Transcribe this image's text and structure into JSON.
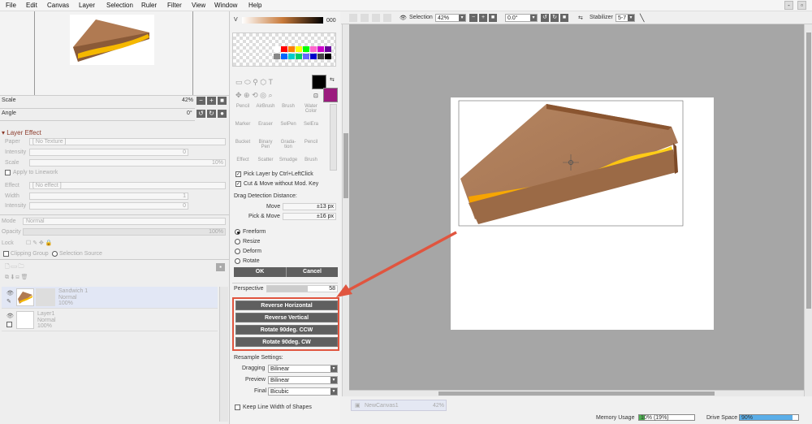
{
  "menu": [
    "File",
    "Edit",
    "Canvas",
    "Layer",
    "Selection",
    "Ruler",
    "Filter",
    "View",
    "Window",
    "Help"
  ],
  "window_controls": {
    "minimize": "-",
    "restore": "▫"
  },
  "navigator": {
    "scale_label": "Scale",
    "scale_value": "42%",
    "angle_label": "Angle",
    "angle_value": "0°"
  },
  "layer_effect": {
    "title": "Layer Effect",
    "paper_label": "Paper",
    "paper_value": "[ No Texture ]",
    "intensity_label": "Intensity",
    "intensity_value": "0",
    "scale_label": "Scale",
    "scale_value": "10%",
    "apply_linework": "Apply to Linework",
    "effect_label": "Effect",
    "effect_value": "[ No effect ]",
    "width_label": "Width",
    "width_value": "1",
    "intensity2_label": "Intensity",
    "intensity2_value": "0"
  },
  "layer_props": {
    "mode_label": "Mode",
    "mode_value": "Normal",
    "opacity_label": "Opacity",
    "opacity_value": "100%",
    "lock_label": "Lock",
    "clipping_group": "Clipping Group",
    "selection_source": "Selection Source"
  },
  "layers": [
    {
      "name": "Sandwich 1",
      "mode": "Normal",
      "opacity": "100%"
    },
    {
      "name": "Layer1",
      "mode": "Normal",
      "opacity": "100%"
    }
  ],
  "color": {
    "v_label": "V",
    "v_value": "000",
    "primary": "#000000",
    "secondary": "#9b1b7e"
  },
  "palette": [
    "#ffffff",
    "#ff0000",
    "#ff7f00",
    "#ffff00",
    "#00ff00",
    "#ff66cc",
    "#cc00cc",
    "#660099",
    "#888888",
    "#0066ff",
    "#00cccc",
    "#00cc66",
    "#6666ff",
    "#0000cc",
    "#444444",
    "#000000"
  ],
  "tools": [
    [
      "Pencil",
      "AirBrush",
      "Brush",
      "Water Color"
    ],
    [
      "Marker",
      "Eraser",
      "SelPen",
      "SelEra"
    ],
    [
      "Bucket",
      "Binary Pen",
      "Grada-tion",
      "Pencil"
    ],
    [
      "Effect",
      "Scatter",
      "Smudge",
      "Brush"
    ]
  ],
  "options": {
    "pick_layer": "Pick Layer by Ctrl+LeftClick",
    "cut_move": "Cut & Move without Mod. Key",
    "drag_detect": "Drag Detection Distance:",
    "move_label": "Move",
    "move_value": "±13 px",
    "pick_move_label": "Pick & Move",
    "pick_move_value": "±16 px"
  },
  "transform_modes": [
    "Freeform",
    "Resize",
    "Deform",
    "Rotate"
  ],
  "buttons": {
    "ok": "OK",
    "cancel": "Cancel"
  },
  "perspective": {
    "label": "Perspective",
    "value": "58"
  },
  "flip_buttons": [
    "Reverse Horizontal",
    "Reverse Vertical",
    "Rotate 90deg. CCW",
    "Rotate 90deg. CW"
  ],
  "resample": {
    "title": "Resample Settings:",
    "dragging_label": "Dragging",
    "dragging_value": "Bilinear",
    "preview_label": "Preview",
    "preview_value": "Bilinear",
    "final_label": "Final",
    "final_value": "Bicubic"
  },
  "keep_line": "Keep Line Width of Shapes",
  "toolbar": {
    "selection_label": "Selection",
    "zoom": "42%",
    "angle": "0.0°",
    "stabilizer_label": "Stabilizer",
    "stabilizer_value": "5-7"
  },
  "canvas_tab": {
    "name": "NewCanvas1",
    "zoom": "42%"
  },
  "status": {
    "memory_label": "Memory Usage",
    "memory_value": "10% (19%)",
    "memory_fraction": 0.1,
    "drive_label": "Drive Space",
    "drive_value": "90%",
    "drive_fraction": 0.9
  }
}
